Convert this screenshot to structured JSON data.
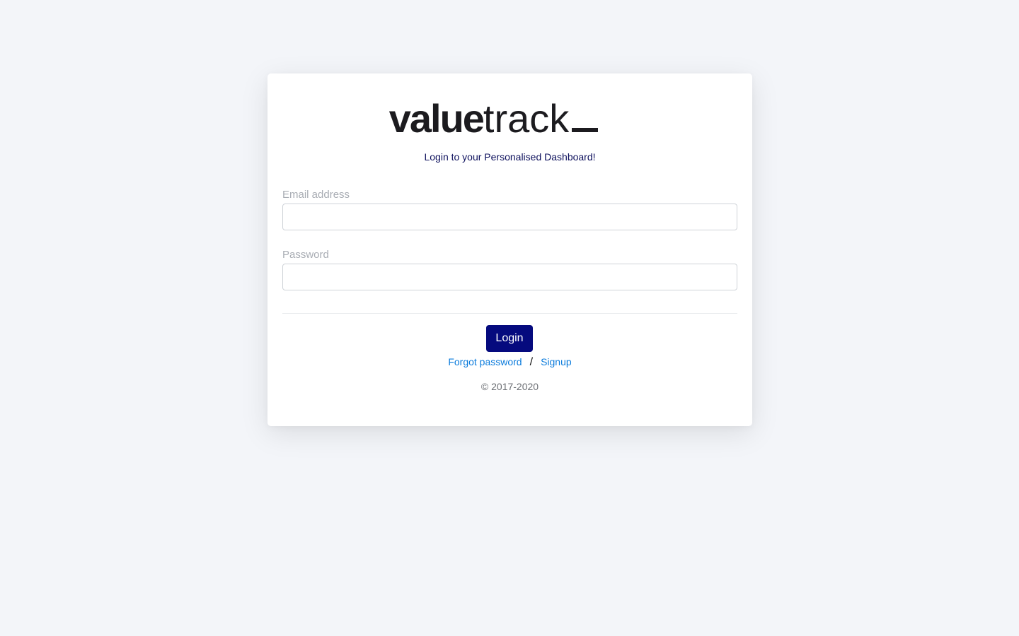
{
  "logo": {
    "bold": "value",
    "light": "track"
  },
  "tagline": "Login to your Personalised Dashboard!",
  "form": {
    "email_label": "Email address",
    "email_value": "",
    "password_label": "Password",
    "password_value": "",
    "login_button": "Login"
  },
  "links": {
    "forgot": "Forgot password",
    "separator": "/",
    "signup": "Signup"
  },
  "copyright": "© 2017-2020",
  "colors": {
    "background": "#f3f5f9",
    "primary_button": "#050a7e",
    "link": "#0a7bdc",
    "tagline": "#0c0f5c"
  }
}
